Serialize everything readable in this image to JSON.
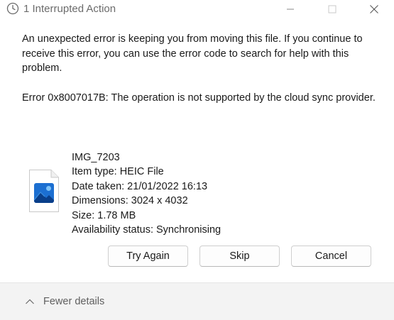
{
  "window": {
    "title": "1 Interrupted Action"
  },
  "message": "An unexpected error is keeping you from moving this file. If you continue to receive this error, you can use the error code to search for help with this problem.",
  "error": "Error 0x8007017B: The operation is not supported by the cloud sync provider.",
  "file": {
    "name": "IMG_7203",
    "item_type": "Item type: HEIC File",
    "date_taken": "Date taken: 21/01/2022 16:13",
    "dimensions": "Dimensions: 3024 x 4032",
    "size": "Size: 1.78 MB",
    "availability": "Availability status: Synchronising",
    "icon": "image-file-icon"
  },
  "buttons": {
    "try_again": "Try Again",
    "skip": "Skip",
    "cancel": "Cancel"
  },
  "footer": {
    "toggle_label": "Fewer details"
  },
  "icons": {
    "title": "clock-icon",
    "minimize": "minimize-icon",
    "maximize": "maximize-icon",
    "close": "close-icon",
    "toggle": "chevron-up-icon"
  },
  "colors": {
    "accent_blue": "#1c6fd1",
    "footer_bg": "#f3f3f3"
  }
}
